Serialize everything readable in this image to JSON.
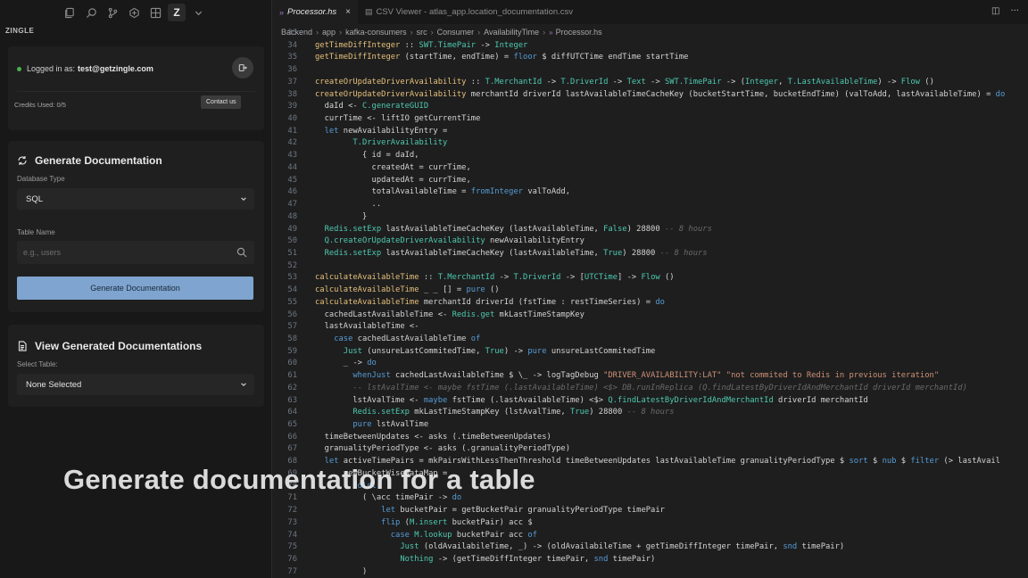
{
  "sidebar": {
    "panel_title": "ZINGLE",
    "login": {
      "prefix": "Logged in as:",
      "email": "test@getzingle.com"
    },
    "credits": "Credits Used: 0/5",
    "contact_label": "Contact us",
    "generate": {
      "title": "Generate Documentation",
      "db_type_label": "Database Type",
      "db_type_value": "SQL",
      "table_name_label": "Table Name",
      "table_name_placeholder": "e.g., users",
      "button_label": "Generate Documentation"
    },
    "view": {
      "title": "View Generated Documentations",
      "select_label": "Select Table:",
      "select_value": "None Selected"
    }
  },
  "tabs": [
    {
      "label": "Processor.hs",
      "active": true
    },
    {
      "label": "CSV Viewer - atlas_app.location_documentation.csv",
      "active": false
    }
  ],
  "breadcrumbs": [
    "Backend",
    "app",
    "kafka-consumers",
    "src",
    "Consumer",
    "AvailabilityTime",
    "Processor.hs"
  ],
  "code_lines": [
    {
      "n": "33",
      "t": ""
    },
    {
      "n": "34",
      "t": "getTimeDiffInteger :: SWT.TimePair -> Integer"
    },
    {
      "n": "35",
      "t": "getTimeDiffInteger (startTime, endTime) = floor $ diffUTCTime endTime startTime"
    },
    {
      "n": "36",
      "t": ""
    },
    {
      "n": "37",
      "t": "createOrUpdateDriverAvailability :: T.MerchantId -> T.DriverId -> Text -> SWT.TimePair -> (Integer, T.LastAvailableTime) -> Flow ()"
    },
    {
      "n": "38",
      "t": "createOrUpdateDriverAvailability merchantId driverId lastAvailableTimeCacheKey (bucketStartTime, bucketEndTime) (valToAdd, lastAvailableTime) = do"
    },
    {
      "n": "39",
      "t": "  daId <- C.generateGUID"
    },
    {
      "n": "40",
      "t": "  currTime <- liftIO getCurrentTime"
    },
    {
      "n": "41",
      "t": "  let newAvailabilityEntry ="
    },
    {
      "n": "42",
      "t": "        T.DriverAvailability"
    },
    {
      "n": "43",
      "t": "          { id = daId,"
    },
    {
      "n": "44",
      "t": "            createdAt = currTime,"
    },
    {
      "n": "45",
      "t": "            updatedAt = currTime,"
    },
    {
      "n": "46",
      "t": "            totalAvailableTime = fromInteger valToAdd,"
    },
    {
      "n": "47",
      "t": "            .."
    },
    {
      "n": "48",
      "t": "          }"
    },
    {
      "n": "49",
      "t": "  Redis.setExp lastAvailableTimeCacheKey (lastAvailableTime, False) 28800 -- 8 hours"
    },
    {
      "n": "50",
      "t": "  Q.createOrUpdateDriverAvailability newAvailabilityEntry"
    },
    {
      "n": "51",
      "t": "  Redis.setExp lastAvailableTimeCacheKey (lastAvailableTime, True) 28800 -- 8 hours"
    },
    {
      "n": "52",
      "t": ""
    },
    {
      "n": "53",
      "t": "calculateAvailableTime :: T.MerchantId -> T.DriverId -> [UTCTime] -> Flow ()"
    },
    {
      "n": "54",
      "t": "calculateAvailableTime _ _ [] = pure ()"
    },
    {
      "n": "55",
      "t": "calculateAvailableTime merchantId driverId (fstTime : restTimeSeries) = do"
    },
    {
      "n": "56",
      "t": "  cachedLastAvailableTime <- Redis.get mkLastTimeStampKey"
    },
    {
      "n": "57",
      "t": "  lastAvailableTime <-"
    },
    {
      "n": "58",
      "t": "    case cachedLastAvailableTime of"
    },
    {
      "n": "59",
      "t": "      Just (unsureLastCommitedTime, True) -> pure unsureLastCommitedTime"
    },
    {
      "n": "60",
      "t": "      _ -> do"
    },
    {
      "n": "61",
      "t": "        whenJust cachedLastAvailableTime $ \\_ -> logTagDebug \"DRIVER_AVAILABILITY:LAT\" \"not commited to Redis in previous iteration\""
    },
    {
      "n": "62",
      "t": "        -- lstAvalTime <- maybe fstTime (.lastAvailableTime) <$> DB.runInReplica (Q.findLatestByDriverIdAndMerchantId driverId merchantId)"
    },
    {
      "n": "63",
      "t": "        lstAvalTime <- maybe fstTime (.lastAvailableTime) <$> Q.findLatestByDriverIdAndMerchantId driverId merchantId"
    },
    {
      "n": "64",
      "t": "        Redis.setExp mkLastTimeStampKey (lstAvalTime, True) 28800 -- 8 hours"
    },
    {
      "n": "65",
      "t": "        pure lstAvalTime"
    },
    {
      "n": "66",
      "t": "  timeBetweenUpdates <- asks (.timeBetweenUpdates)"
    },
    {
      "n": "67",
      "t": "  granualityPeriodType <- asks (.granualityPeriodType)"
    },
    {
      "n": "68",
      "t": "  let activeTimePairs = mkPairsWithLessThenThreshold timeBetweenUpdates lastAvailableTime granualityPeriodType $ sort $ nub $ filter (> lastAvail"
    },
    {
      "n": "69",
      "t": "      newBucketWiseDataMap ="
    },
    {
      "n": "70",
      "t": "        foldl"
    },
    {
      "n": "71",
      "t": "          ( \\acc timePair -> do"
    },
    {
      "n": "72",
      "t": "              let bucketPair = getBucketPair granualityPeriodType timePair"
    },
    {
      "n": "73",
      "t": "              flip (M.insert bucketPair) acc $"
    },
    {
      "n": "74",
      "t": "                case M.lookup bucketPair acc of"
    },
    {
      "n": "75",
      "t": "                  Just (oldAvailabileTime, _) -> (oldAvailabileTime + getTimeDiffInteger timePair, snd timePair)"
    },
    {
      "n": "76",
      "t": "                  Nothing -> (getTimeDiffInteger timePair, snd timePair)"
    },
    {
      "n": "77",
      "t": "          )"
    }
  ],
  "caption": "Generate documentation for a table"
}
